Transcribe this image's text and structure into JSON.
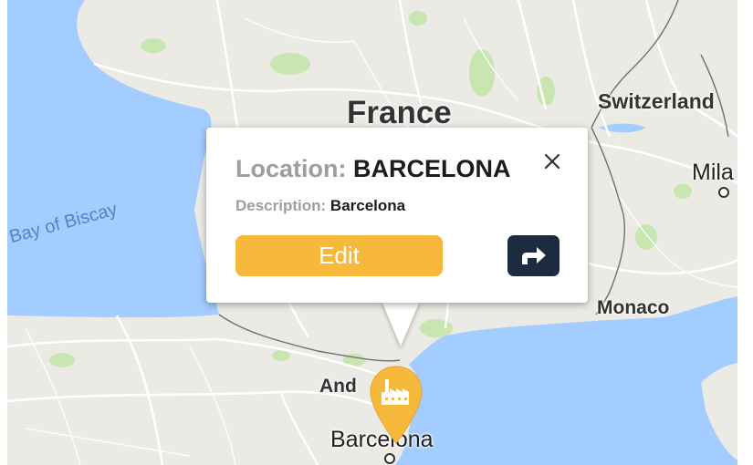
{
  "map": {
    "labels": {
      "france": "France",
      "switzerland": "Switzerland",
      "milan": "Mila",
      "bay_of_biscay": "Bay of Biscay",
      "monaco": "Monaco",
      "andorra": "And",
      "barcelona": "Barcelona"
    },
    "colors": {
      "land": "#eceae4",
      "water": "#a3ccff",
      "park": "#c8e6b0",
      "border": "#6f6f6f",
      "road": "#ffffff"
    }
  },
  "popup": {
    "location_label": "Location:",
    "location_value": "BARCELONA",
    "description_label": "Description:",
    "description_value": "Barcelona",
    "edit_label": "Edit",
    "close_icon": "close-icon",
    "directions_icon": "directions-arrow-icon",
    "colors": {
      "edit_button": "#f6b93b",
      "directions_button": "#1c2b3f",
      "label_gray": "#9e9e9e"
    }
  },
  "marker": {
    "icon": "factory-icon",
    "color": "#f6b93b"
  }
}
